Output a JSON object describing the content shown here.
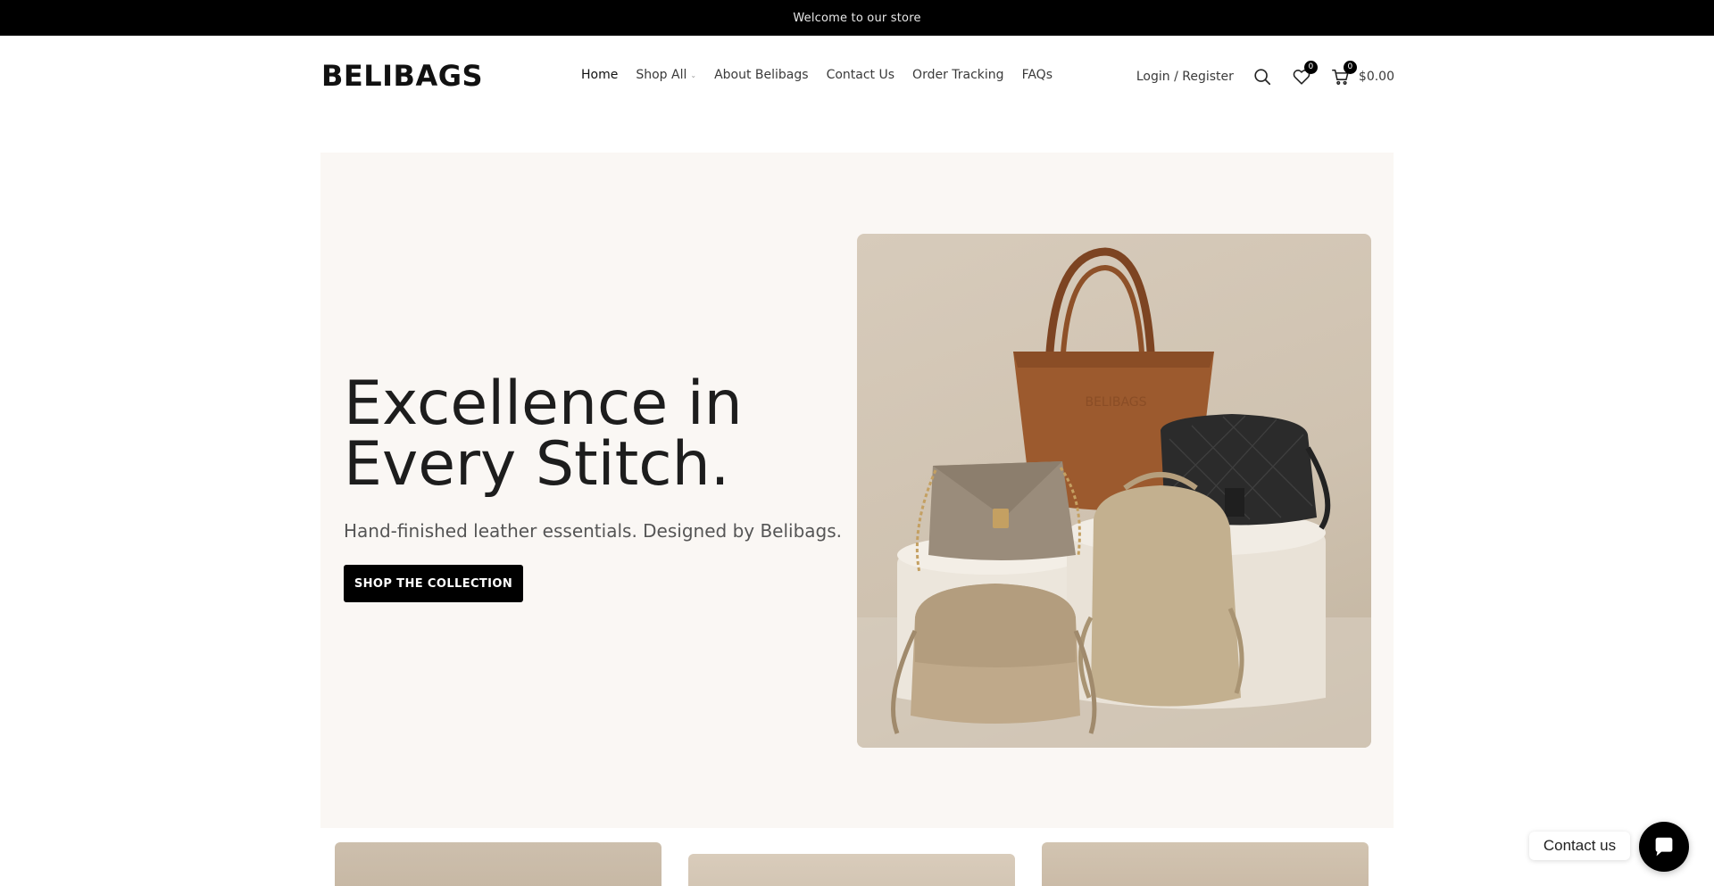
{
  "topbar": {
    "text": "Welcome to our store"
  },
  "header": {
    "logo": "BELIBAGS",
    "nav": [
      {
        "label": "Home",
        "active": true
      },
      {
        "label": "Shop All",
        "has_dropdown": true
      },
      {
        "label": "About Belibags"
      },
      {
        "label": "Contact Us"
      },
      {
        "label": "Order Tracking"
      },
      {
        "label": "FAQs"
      }
    ],
    "login_label": "Login / Register",
    "wishlist_count": "0",
    "cart_count": "0",
    "cart_total": "$0.00"
  },
  "hero": {
    "title_line1": "Excellence in",
    "title_line2": "Every Stitch.",
    "subtitle": "Hand-finished leather essentials. Designed by Belibags.",
    "button_label": "SHOP THE COLLECTION",
    "image_brand_text": "BELIBAGS"
  },
  "contact_widget": {
    "label": "Contact us",
    "icon": "chat-icon"
  },
  "colors": {
    "topbar_bg": "#000000",
    "hero_bg": "#faf7f4",
    "button_bg": "#000000",
    "tote": "#9c5a2e",
    "quilted": "#2b2b2b",
    "taupe": "#b8a48a"
  }
}
